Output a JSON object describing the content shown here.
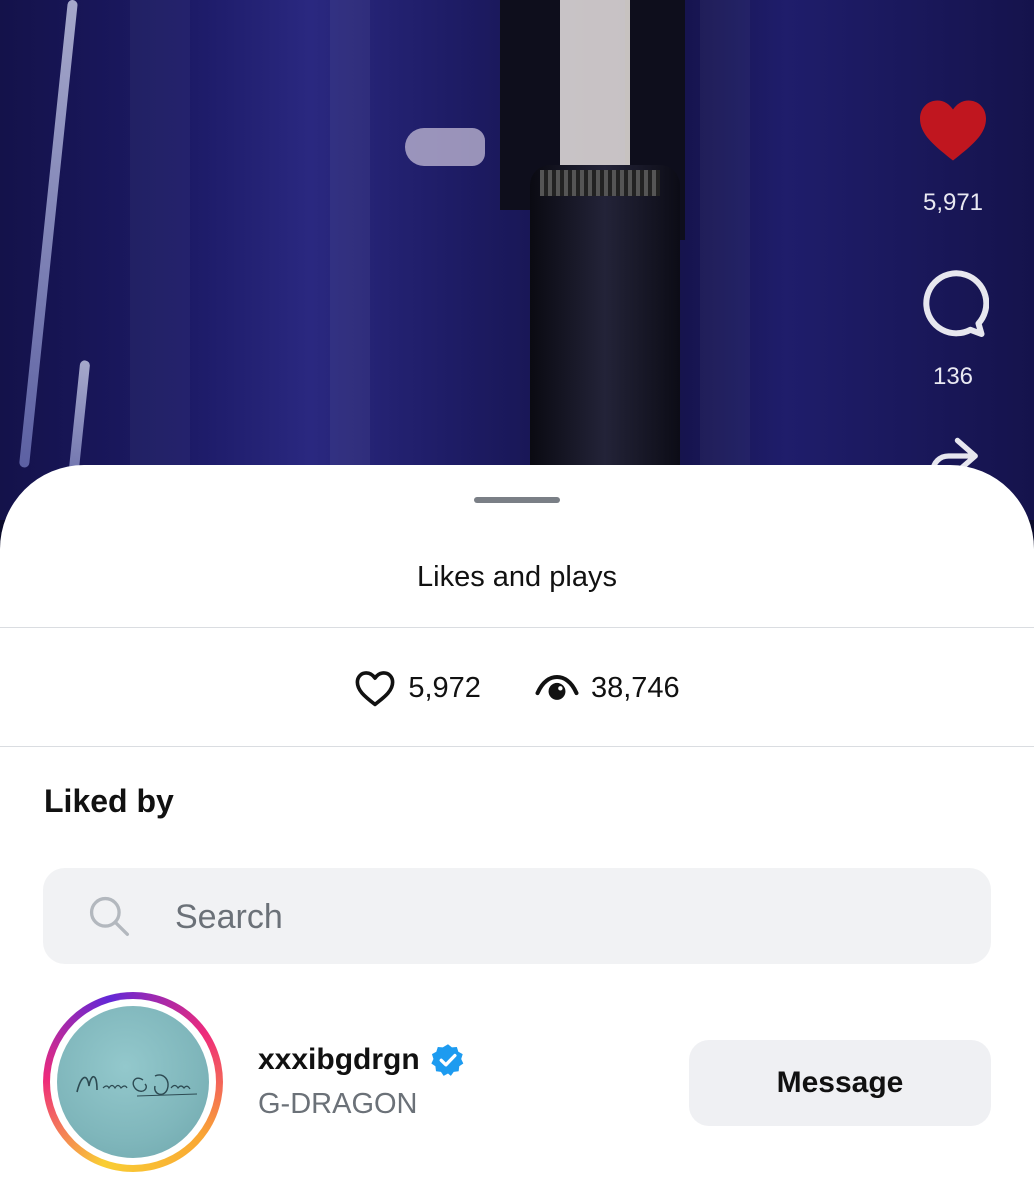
{
  "video": {
    "like_count": "5,971",
    "comment_count": "136",
    "like_color": "#c0161f"
  },
  "sheet": {
    "title": "Likes and plays",
    "likes": "5,972",
    "views": "38,746",
    "liked_by_label": "Liked by",
    "search_placeholder": "Search"
  },
  "users": [
    {
      "username": "xxxibgdrgn",
      "full_name": "G-DRAGON",
      "verified": true,
      "avatar_text": "Monsieur G-Dragon",
      "button_label": "Message"
    }
  ],
  "colors": {
    "verified_badge": "#1d9bf0",
    "ring_gradient": [
      "#f9ce34",
      "#ee2a7b",
      "#6228d7"
    ]
  },
  "icons": [
    "heart-filled-icon",
    "comment-icon",
    "share-icon",
    "heart-outline-icon",
    "eye-icon",
    "search-icon",
    "verified-badge-icon"
  ]
}
